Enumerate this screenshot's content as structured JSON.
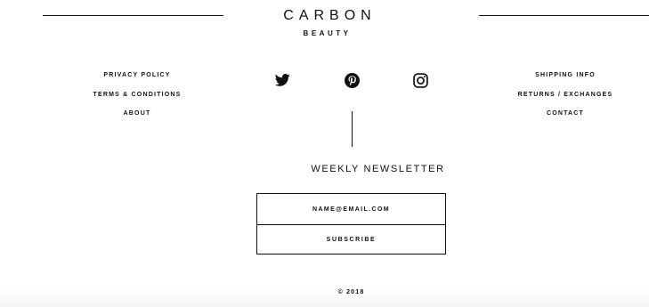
{
  "brand": {
    "name": "CARBON",
    "subtitle": "BEAUTY"
  },
  "footer_links_left": [
    {
      "label": "PRIVACY POLICY"
    },
    {
      "label": "TERMS & CONDITIONS"
    },
    {
      "label": "ABOUT"
    }
  ],
  "footer_links_right": [
    {
      "label": "SHIPPING INFO"
    },
    {
      "label": "RETURNS / EXCHANGES"
    },
    {
      "label": "CONTACT"
    }
  ],
  "social": [
    {
      "icon": "twitter-icon"
    },
    {
      "icon": "pinterest-icon"
    },
    {
      "icon": "instagram-icon"
    }
  ],
  "newsletter": {
    "title": "WEEKLY NEWSLETTER",
    "email_placeholder": "NAME@EMAIL.COM",
    "subscribe_label": "SUBSCRIBE"
  },
  "copyright": "© 2018",
  "colors": {
    "text": "#111111",
    "background": "#ffffff"
  }
}
